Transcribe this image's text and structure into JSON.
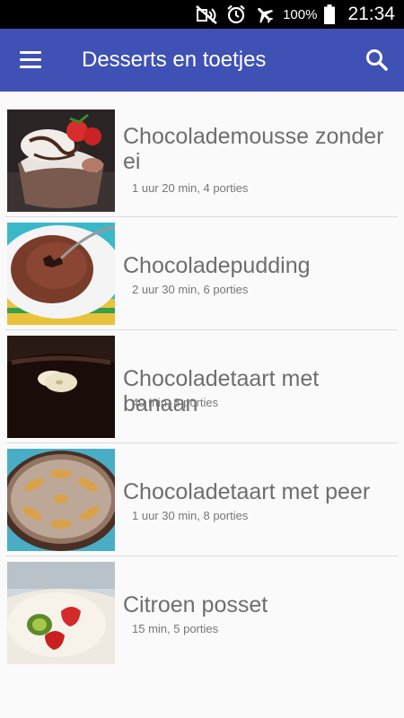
{
  "status_bar": {
    "battery": "100%",
    "time": "21:34"
  },
  "app_bar": {
    "title": "Desserts en toetjes"
  },
  "recipes": [
    {
      "title": "Chocolademousse zonder ei",
      "meta": "1 uur 20 min, 4 porties"
    },
    {
      "title": "Chocoladepudding",
      "meta": "2 uur 30 min, 6 porties"
    },
    {
      "title": "Chocoladetaart met banaan",
      "meta": "40 min, 8 porties"
    },
    {
      "title": "Chocoladetaart met peer",
      "meta": "1 uur 30 min, 8 porties"
    },
    {
      "title": "Citroen posset",
      "meta": "15 min, 5 porties"
    }
  ],
  "icons": {
    "menu": "hamburger-menu-icon",
    "search": "search-icon",
    "status": [
      "mute-icon",
      "alarm-icon",
      "airplane-mode-icon",
      "battery-icon"
    ]
  },
  "colors": {
    "app_bar": "#3f51b5",
    "status_bar": "#000000",
    "title_text": "#6e6e6e"
  }
}
